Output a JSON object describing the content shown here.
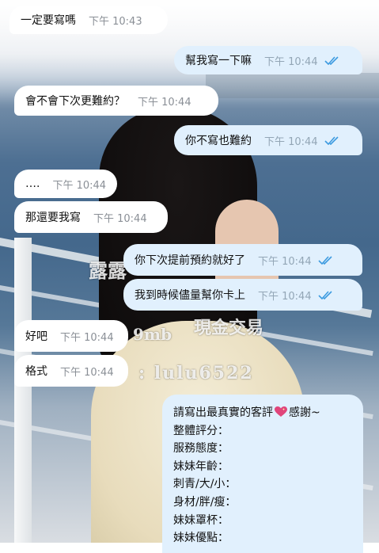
{
  "chat": {
    "messages": [
      {
        "text": "一定要寫嗎",
        "time": "下午 10:43",
        "side": "in"
      },
      {
        "text": "幫我寫一下嘛",
        "time": "下午 10:44",
        "side": "out",
        "status": "read"
      },
      {
        "text": "會不會下次更難約？",
        "time": "下午 10:44",
        "side": "in"
      },
      {
        "text": "你不寫也難約",
        "time": "下午 10:44",
        "side": "out",
        "status": "read"
      },
      {
        "text": "….",
        "time": "下午 10:44",
        "side": "in"
      },
      {
        "text": "那還要我寫",
        "time": "下午 10:44",
        "side": "in"
      },
      {
        "text": "你下次提前預約就好了",
        "time": "下午 10:44",
        "side": "out",
        "status": "read"
      },
      {
        "text": "我到時候儘量幫你卡上",
        "time": "下午 10:44",
        "side": "out",
        "status": "read"
      },
      {
        "text": "好吧",
        "time": "下午 10:44",
        "side": "in"
      },
      {
        "text": "格式",
        "time": "下午 10:44",
        "side": "in"
      }
    ],
    "review_card": {
      "intro_before_emoji": "請寫出最真實的客評",
      "emoji": "sparkling-heart-icon",
      "intro_after_emoji": "感謝~",
      "lines": [
        "整體評分：",
        "服務態度：",
        "妹妹年齡：",
        "刺青/大/小：",
        "身材/胖/瘦：",
        "妹妹罩杯：",
        "妹妹優點："
      ]
    }
  },
  "watermark": {
    "name": "露露",
    "size": "9mb",
    "trade": "現金交易",
    "id": "lulu6522"
  },
  "colors": {
    "incoming_bubble": "#ffffff",
    "outgoing_bubble": "#e1f0fd",
    "read_ticks": "#3d9be0",
    "time_text": "#8a8f96"
  }
}
